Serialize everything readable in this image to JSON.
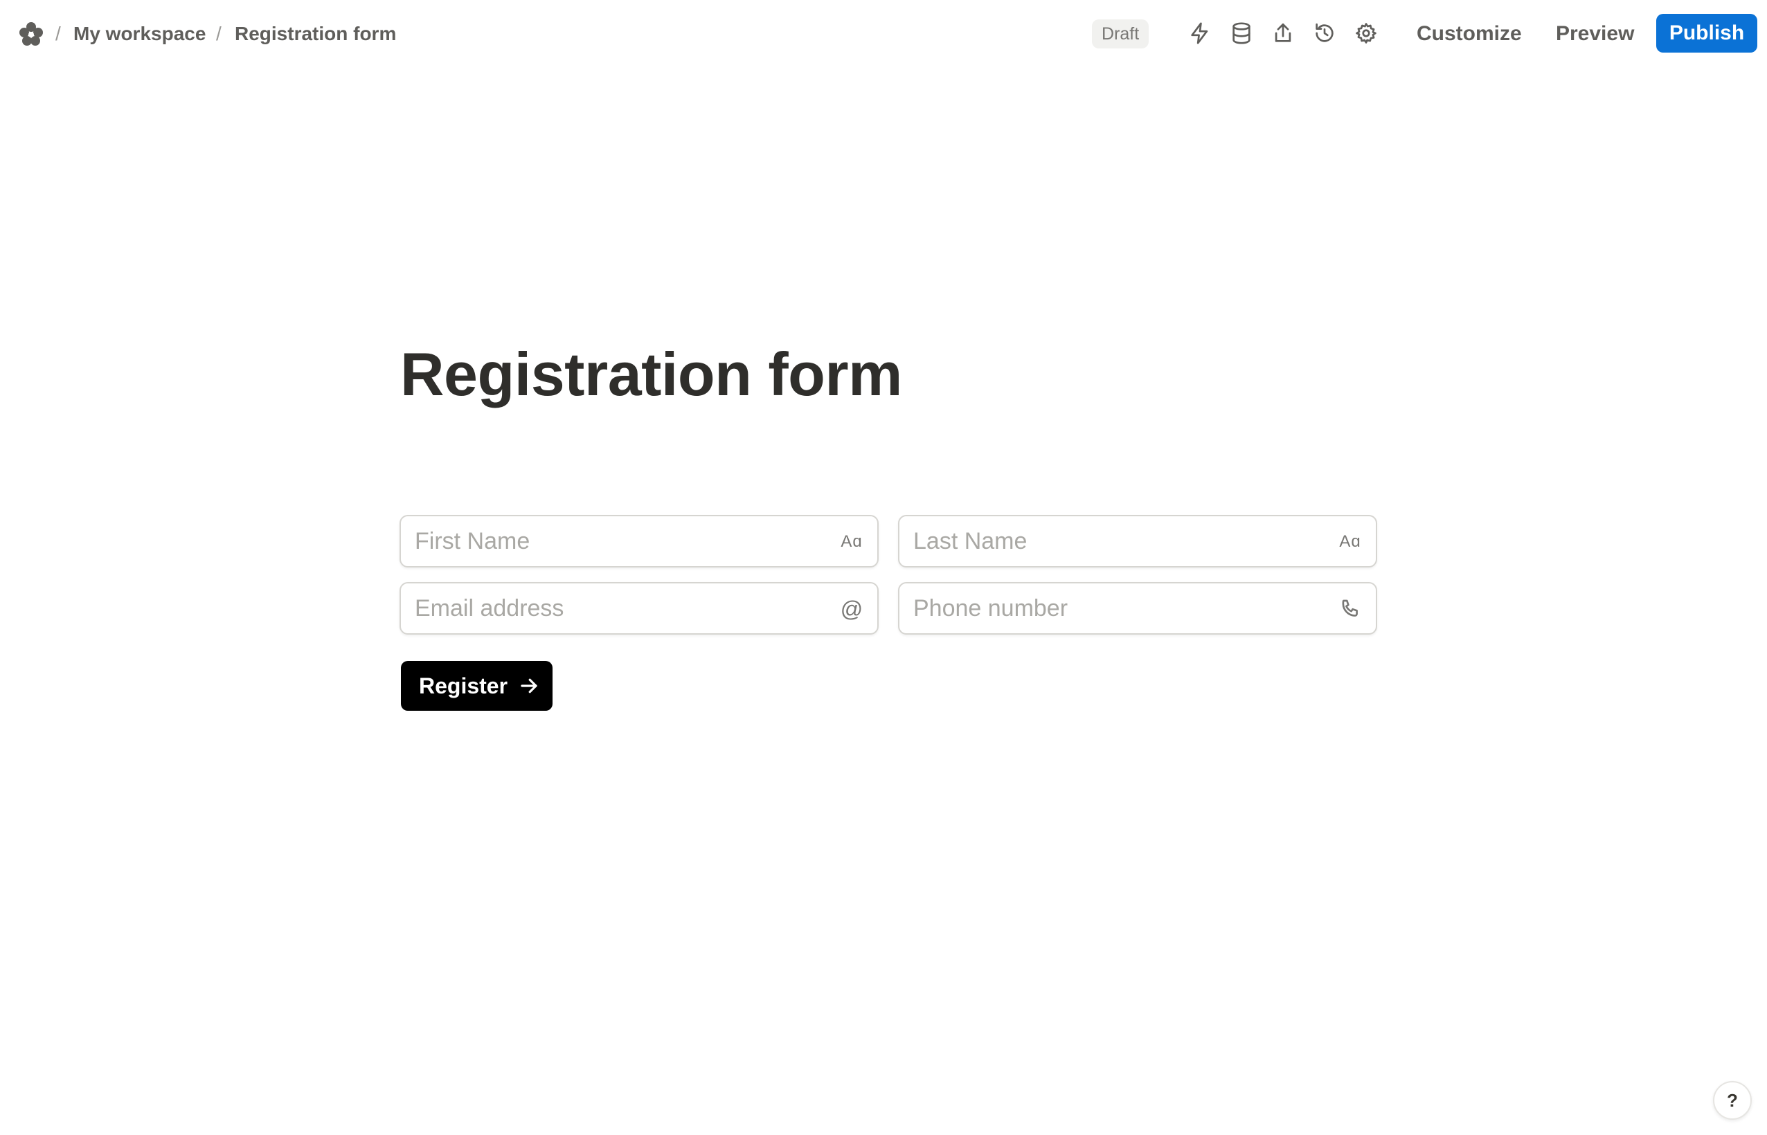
{
  "header": {
    "logo_icon": "flower-logo-icon",
    "breadcrumbs": [
      {
        "label": "My workspace"
      },
      {
        "label": "Registration form"
      }
    ],
    "separator": "/",
    "status_badge": "Draft",
    "icons": [
      "lightning-icon",
      "database-icon",
      "share-icon",
      "history-icon",
      "gear-icon"
    ],
    "customize_label": "Customize",
    "preview_label": "Preview",
    "publish_label": "Publish",
    "publish_color": "#0b72d6"
  },
  "form": {
    "title": "Registration form",
    "fields": {
      "first_name": {
        "placeholder": "First Name",
        "icon": "text-aa-icon",
        "icon_text": "Aɑ"
      },
      "last_name": {
        "placeholder": "Last Name",
        "icon": "text-aa-icon",
        "icon_text": "Aɑ"
      },
      "email": {
        "placeholder": "Email address",
        "icon": "at-sign-icon",
        "icon_text": "@"
      },
      "phone": {
        "placeholder": "Phone number",
        "icon": "phone-icon"
      }
    },
    "submit_label": "Register",
    "submit_icon": "arrow-right-icon"
  },
  "help": {
    "label": "?"
  }
}
